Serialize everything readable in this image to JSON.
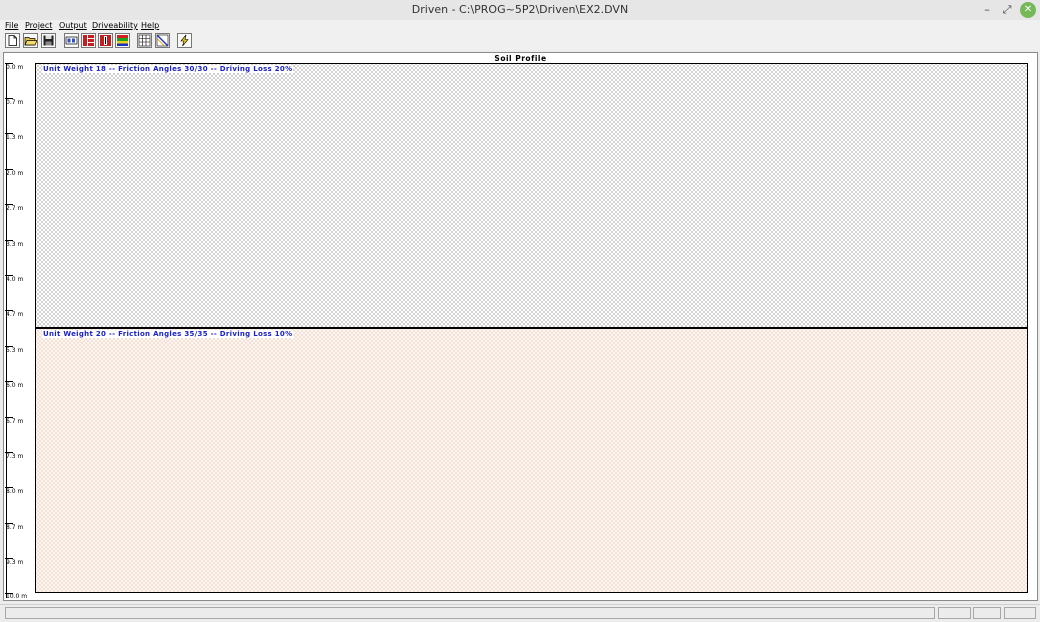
{
  "window": {
    "title": "Driven - C:\\PROG~5P2\\Driven\\EX2.DVN",
    "minimize_glyph": "–",
    "restore_glyph": "⤢",
    "close_glyph": "✕"
  },
  "menu": [
    {
      "label": "File"
    },
    {
      "label": "Project"
    },
    {
      "label": "Output"
    },
    {
      "label": "Driveability"
    },
    {
      "label": "Help"
    }
  ],
  "toolbar": [
    {
      "icon": "new-document-icon"
    },
    {
      "icon": "open-folder-icon"
    },
    {
      "icon": "save-disk-icon"
    },
    {
      "icon": "soil-data-icon"
    },
    {
      "icon": "pile-layers-icon"
    },
    {
      "icon": "pile-icon"
    },
    {
      "icon": "colored-bars-icon"
    },
    {
      "icon": "table-grid-icon"
    },
    {
      "icon": "diagonal-chart-icon"
    },
    {
      "icon": "lightning-icon"
    }
  ],
  "profile": {
    "title": "Soil Profile",
    "depth_labels": [
      "0.0 m",
      "0.7 m",
      "1.3 m",
      "2.0 m",
      "2.7 m",
      "3.3 m",
      "4.0 m",
      "4.7 m",
      "5.3 m",
      "6.0 m",
      "6.7 m",
      "7.3 m",
      "8.0 m",
      "8.7 m",
      "9.3 m",
      "10.0 m"
    ],
    "layers": [
      {
        "label": "Unit Weight 18 -- Friction Angles 30/30 -- Driving Loss 20%",
        "pattern_color": "#4a4a4a"
      },
      {
        "label": "Unit Weight 20 -- Friction Angles 35/35 -- Driving Loss 10%",
        "pattern_color": "#d9a58c"
      }
    ]
  },
  "colors": {
    "label_text": "#1a22c8",
    "layer2_fill": "#fdf6f1",
    "close_button": "#74b857"
  },
  "statusbar": {
    "panels": 4
  }
}
